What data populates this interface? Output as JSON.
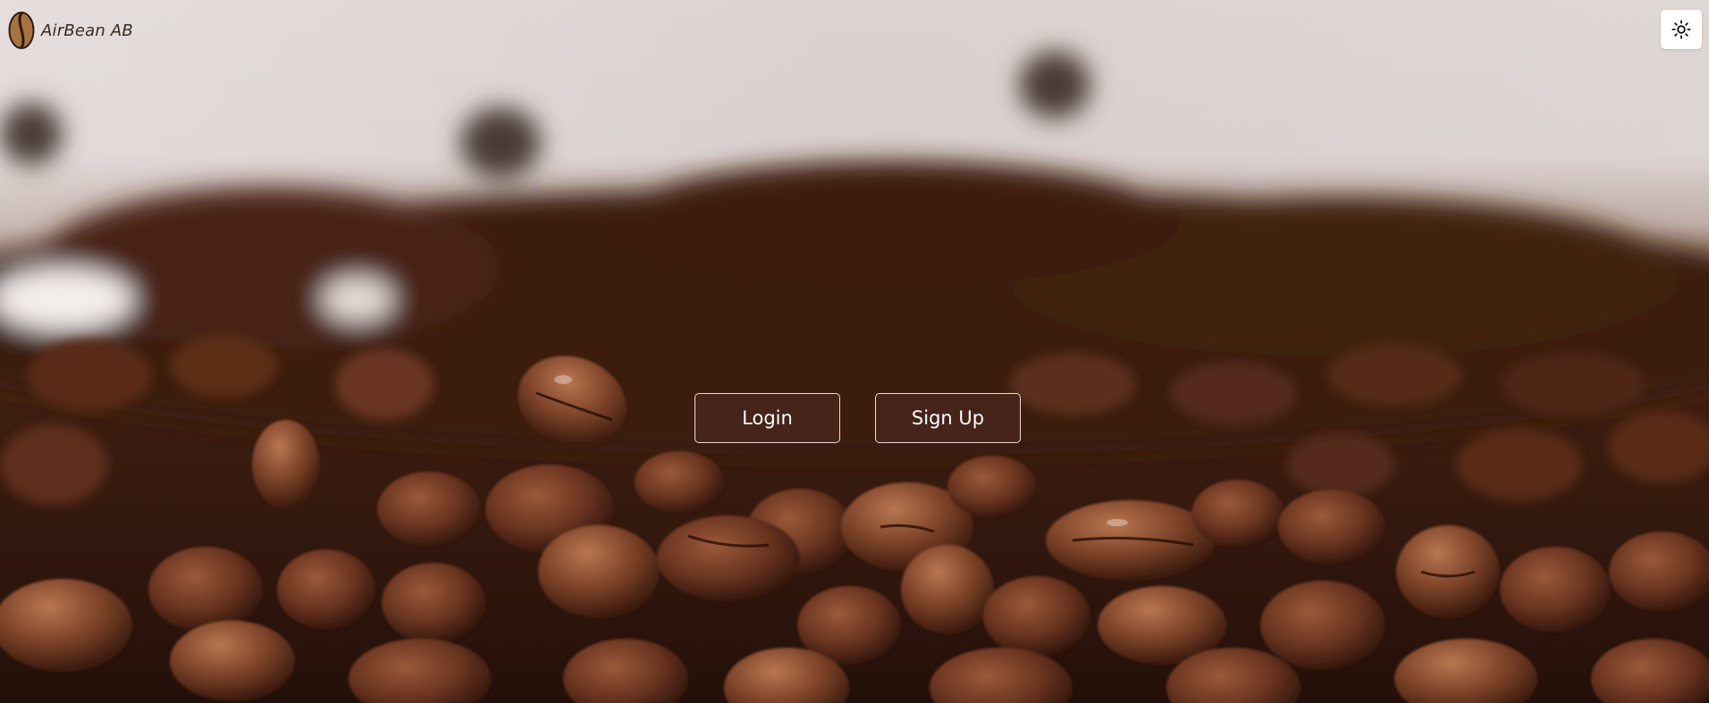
{
  "header": {
    "brand_name": "AirBean AB",
    "logo_icon": "coffee-bean-icon",
    "theme_toggle_icon": "sun-icon"
  },
  "hero": {
    "background": "coffee-beans-photo",
    "login_label": "Login",
    "signup_label": "Sign Up"
  },
  "colors": {
    "button_bg": "#48261c",
    "button_border": "#e8ddd6",
    "button_text": "#ffffff",
    "brand_text": "#3a2a24"
  }
}
